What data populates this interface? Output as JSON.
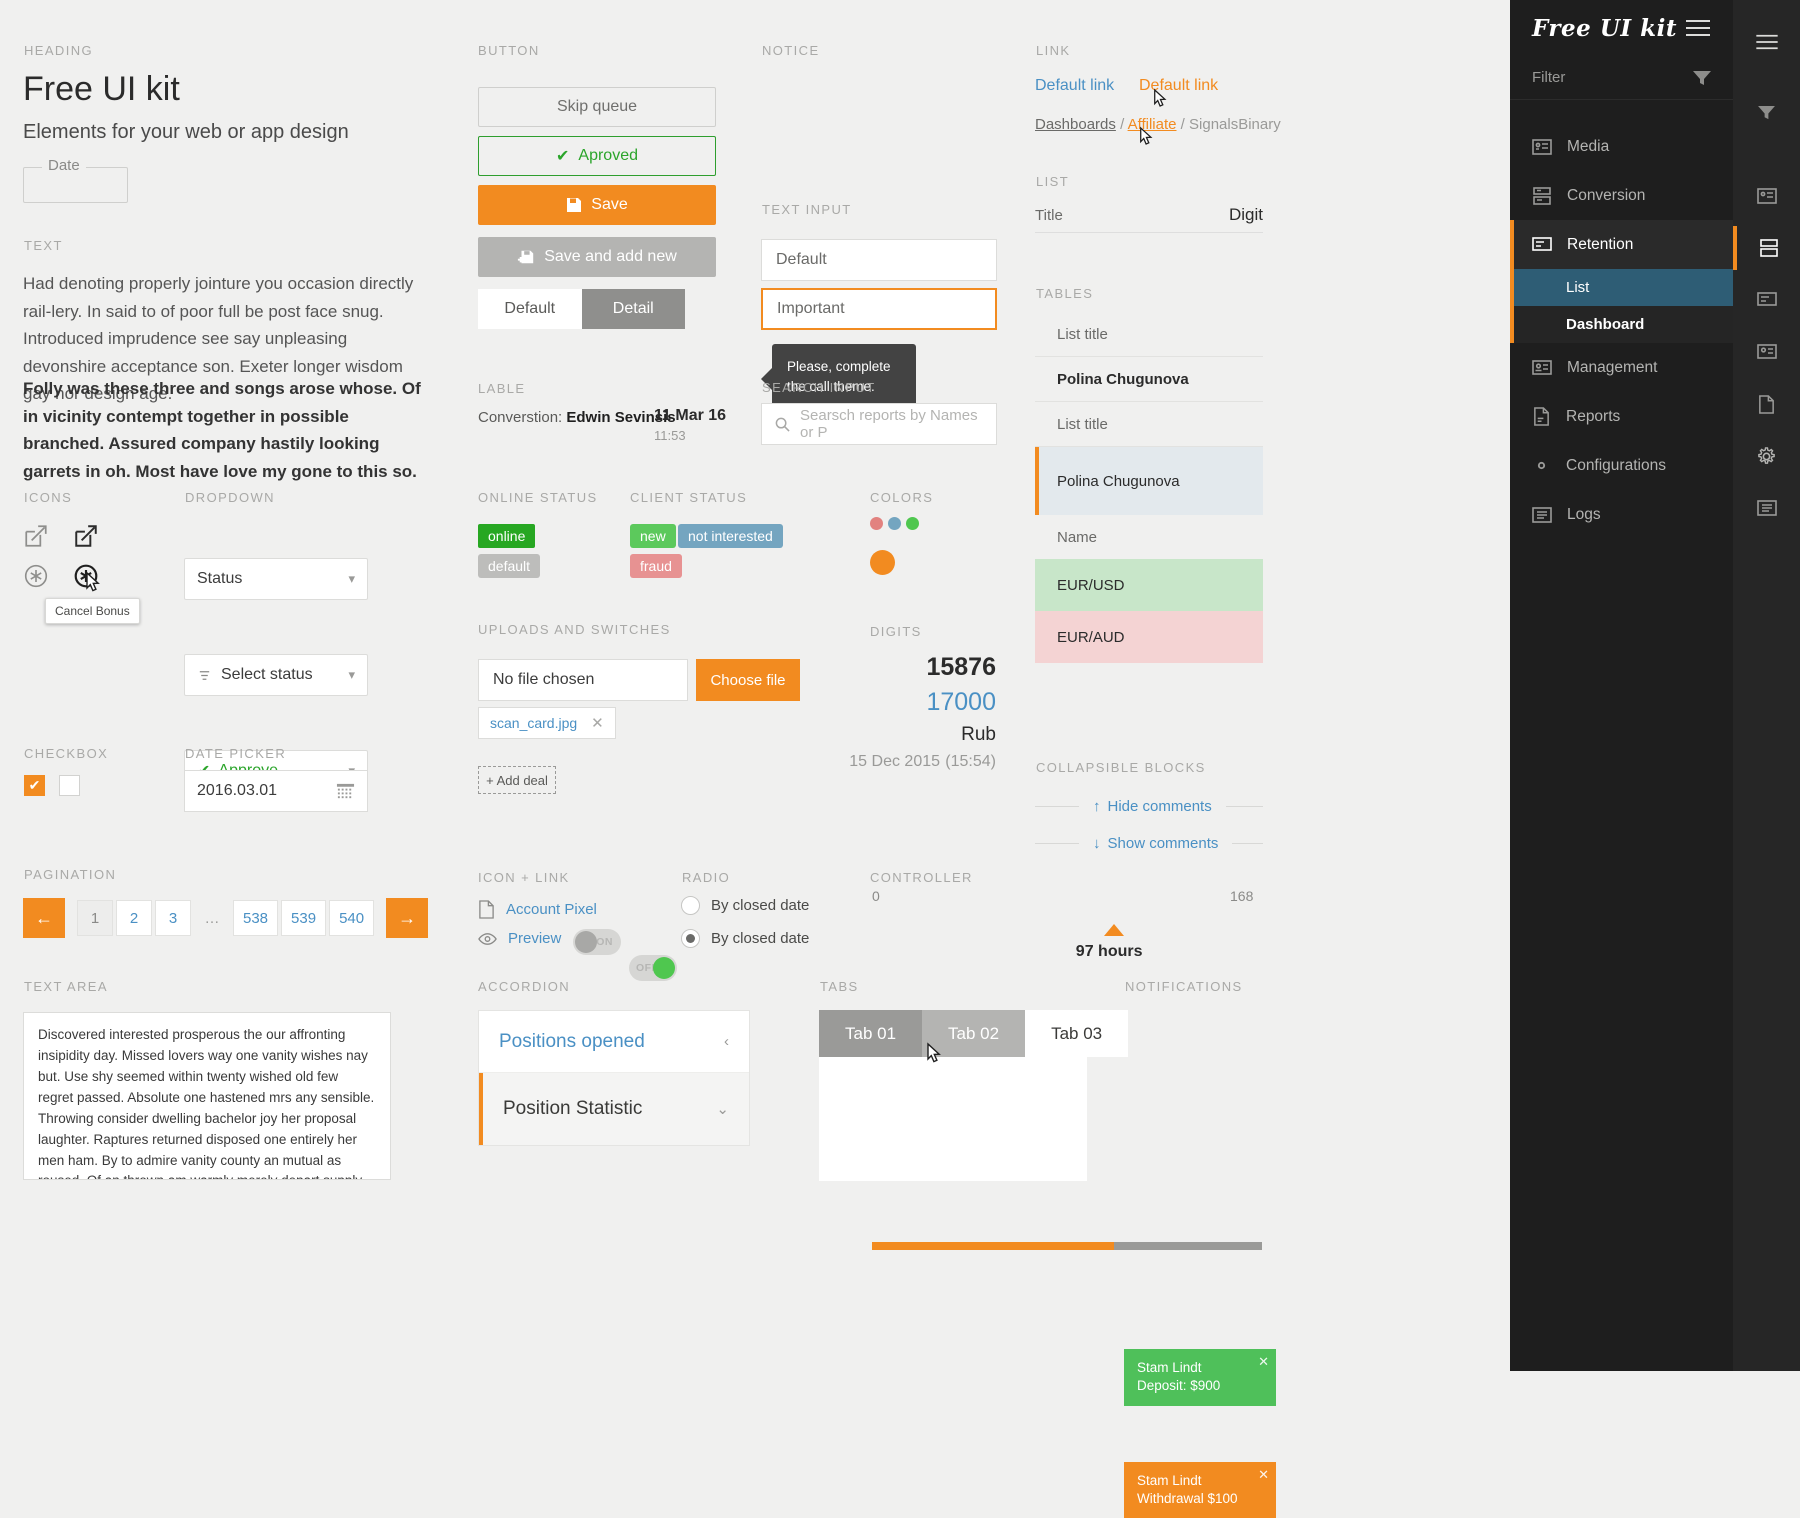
{
  "sections": {
    "heading": "HEADING",
    "text": "TEXT",
    "icons": "ICONS",
    "dropdown": "DROPDOWN",
    "checkbox": "CHECKBOX",
    "date_picker": "DATE PICKER",
    "pagination": "PAGINATION",
    "text_area": "TEXT AREA",
    "button": "BUTTON",
    "lable": "LABLE",
    "online_status": "ONLINE STATUS",
    "client_status": "CLIENT STATUS",
    "uploads": "UPLOADS AND SWITCHES",
    "icon_link": "ICON + LINK",
    "accordion": "ACCORDION",
    "notice": "NOTICE",
    "text_input": "TEXT INPUT",
    "search_input": "SEARCH INPUT",
    "radio": "RADIO",
    "tabs": "TABS",
    "link": "LINK",
    "list": "LIST",
    "tables": "TABLES",
    "colors": "COLORS",
    "digits": "DIGITS",
    "collapsible": "COLLAPSIBLE BLOCKS",
    "controller": "CONTROLLER",
    "notifications": "NOTIFICATIONS"
  },
  "heading": {
    "title": "Free UI kit",
    "subtitle": "Elements for your web or app design",
    "date_legend": "Date"
  },
  "text": {
    "p1": "Had denoting properly jointure you occasion directly rail-lery. In said to of poor full be post face snug. Introduced imprudence see say unpleasing devonshire acceptance son. Exeter longer wisdom gay nor design age.",
    "p2": "Folly was these three and songs arose whose. Of in vicinity contempt together in possible branched. Assured company hastily looking garrets in oh. Most have love my gone to this so."
  },
  "icons": {
    "tooltip": "Cancel Bonus",
    "names": [
      "edit-square-icon",
      "edit-square-icon-dark",
      "cancel-bonus-icon",
      "cancel-bonus-icon-dark"
    ]
  },
  "dropdown": {
    "status": "Status",
    "select_status": "Select status",
    "approve": "Approve"
  },
  "date_picker": {
    "value": "2016.03.01"
  },
  "pagination": {
    "pages": [
      "1",
      "2",
      "3",
      "…",
      "538",
      "539",
      "540"
    ],
    "current": "1"
  },
  "text_area": {
    "value": "Discovered interested prosperous the our affronting insipidity day. Missed lovers way one vanity wishes nay but. Use shy seemed within twenty wished old few regret passed. Absolute one hastened mrs any sensible. Throwing consider dwelling bachelor joy her proposal laughter. Raptures returned disposed one entirely her men ham. By to admire vanity county an mutual as roused. Of an thrown am warmly merely depart supply. Required honoured trifling eat pleasure man relation."
  },
  "buttons": {
    "skip_queue": "Skip queue",
    "approved": "Aproved",
    "save": "Save",
    "save_add_new": "Save and add new",
    "segment_default": "Default",
    "segment_detail": "Detail"
  },
  "lable": {
    "prefix": "Converstion:",
    "name": "Edwin Sevinsis",
    "date": "11 Mar 16",
    "time": "11:53"
  },
  "online_status": {
    "online": "online",
    "default": "default"
  },
  "client_status": {
    "new": "new",
    "not_interested": "not interested",
    "fraud": "fraud"
  },
  "uploads": {
    "no_file": "No file chosen",
    "choose_file": "Choose file",
    "chip_file": "scan_card.jpg",
    "add_deal": "+ Add deal",
    "on": "ON",
    "off": "OFF"
  },
  "icon_link": {
    "account_pixel": "Account Pixel",
    "preview": "Preview"
  },
  "accordion": {
    "positions_opened": "Positions opened",
    "position_statistic": "Position Statistic"
  },
  "notice": {
    "message": "Please, complete the call theme."
  },
  "text_input": {
    "default": "Default",
    "important": "Important"
  },
  "search_input": {
    "placeholder": "Searsch reports by Names or P"
  },
  "radio": {
    "option1": "By closed date",
    "option2": "By closed date"
  },
  "tabs": {
    "items": [
      "Tab 01",
      "Tab 02",
      "Tab 03"
    ],
    "active": "Tab 03"
  },
  "link": {
    "default_blue": "Default link",
    "default_orange": "Default link",
    "crumb1": "Dashboards",
    "sep": "/",
    "crumb2": "Affiliate",
    "crumb3": "SignalsBinary"
  },
  "list": {
    "title": "Title",
    "digit": "Digit"
  },
  "tables": {
    "list_title_1": "List title",
    "row_1": "Polina  Chugunova",
    "list_title_2": "List title",
    "row_2": "Polina Chugunova",
    "name_header": "Name",
    "pair_green": "EUR/USD",
    "pair_red": "EUR/AUD"
  },
  "colors": {
    "small_dots": [
      "#e2827f",
      "#74a5c0",
      "#4fc74f"
    ],
    "big_dot": "#f28b20",
    "accent": "#f28b20"
  },
  "digits": {
    "d1": "15876",
    "d2": "17000",
    "currency": "Rub",
    "date": "15 Dec 2015",
    "time": "(15:54)"
  },
  "collapsible": {
    "hide": "Hide comments",
    "show": "Show comments"
  },
  "controller": {
    "min": "0",
    "max": "168",
    "value_label": "97 hours",
    "percent": 62
  },
  "notifications": [
    {
      "line1": "Stam Lindt",
      "line2": "Deposit: $900",
      "color": "green"
    },
    {
      "line1": "Stam Lindt",
      "line2": "Withdrawal $100",
      "color": "orange"
    }
  ],
  "sidebar": {
    "logo": "Free UI kit",
    "filter": "Filter",
    "items": [
      {
        "label": "Media",
        "icon": "media-icon"
      },
      {
        "label": "Conversion",
        "icon": "conversion-icon"
      },
      {
        "label": "Retention",
        "icon": "retention-icon"
      },
      {
        "label": "Management",
        "icon": "management-icon"
      },
      {
        "label": "Reports",
        "icon": "reports-icon"
      },
      {
        "label": "Configurations",
        "icon": "gear-icon"
      },
      {
        "label": "Logs",
        "icon": "logs-icon"
      }
    ],
    "sub_items": [
      {
        "label": "List"
      },
      {
        "label": "Dashboard"
      }
    ],
    "active": "Retention",
    "active_sub": "List"
  }
}
